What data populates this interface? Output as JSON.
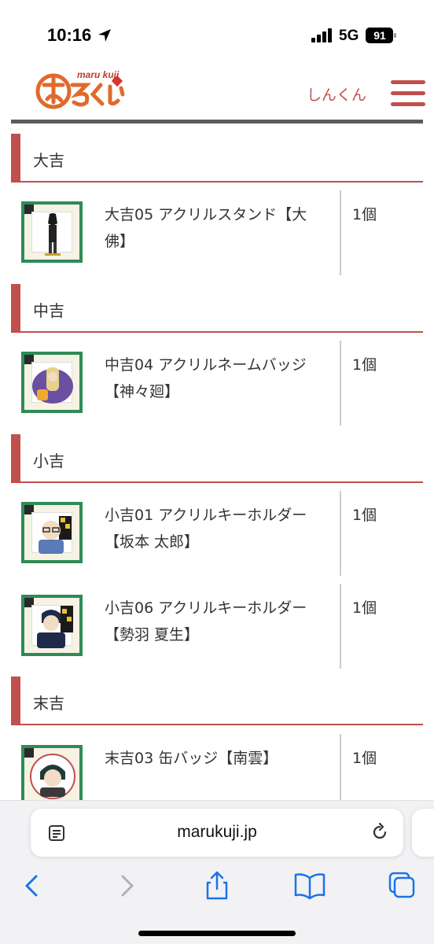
{
  "status_bar": {
    "time": "10:16",
    "network": "5G",
    "battery": "91",
    "icons": [
      "location-arrow-icon",
      "signal-bars-icon",
      "battery-icon"
    ]
  },
  "header": {
    "logo_text": "maru kuji",
    "logo_icon": "marukuji-logo",
    "user_name": "しんくん",
    "menu_icon": "hamburger-menu-icon"
  },
  "sections": [
    {
      "title": "大吉",
      "items": [
        {
          "name": "大吉05 アクリルスタンド【大佛】",
          "qty": "1個"
        }
      ]
    },
    {
      "title": "中吉",
      "items": [
        {
          "name": "中吉04 アクリルネームバッジ【神々廻】",
          "qty": "1個"
        }
      ]
    },
    {
      "title": "小吉",
      "items": [
        {
          "name": "小吉01 アクリルキーホルダー【坂本 太郎】",
          "qty": "1個"
        },
        {
          "name": "小吉06 アクリルキーホルダー【勢羽 夏生】",
          "qty": "1個"
        }
      ]
    },
    {
      "title": "末吉",
      "items": [
        {
          "name": "末吉03 缶バッジ【南雲】",
          "qty": "1個"
        }
      ]
    }
  ],
  "browser": {
    "url": "marukuji.jp",
    "icons": [
      "reader-mode-icon",
      "reload-icon",
      "back-icon",
      "forward-icon",
      "share-icon",
      "bookmarks-icon",
      "tabs-icon"
    ]
  },
  "colors": {
    "accent": "#c0504d",
    "thumb_border": "#2e8b57",
    "browser_blue": "#1a73e8"
  }
}
